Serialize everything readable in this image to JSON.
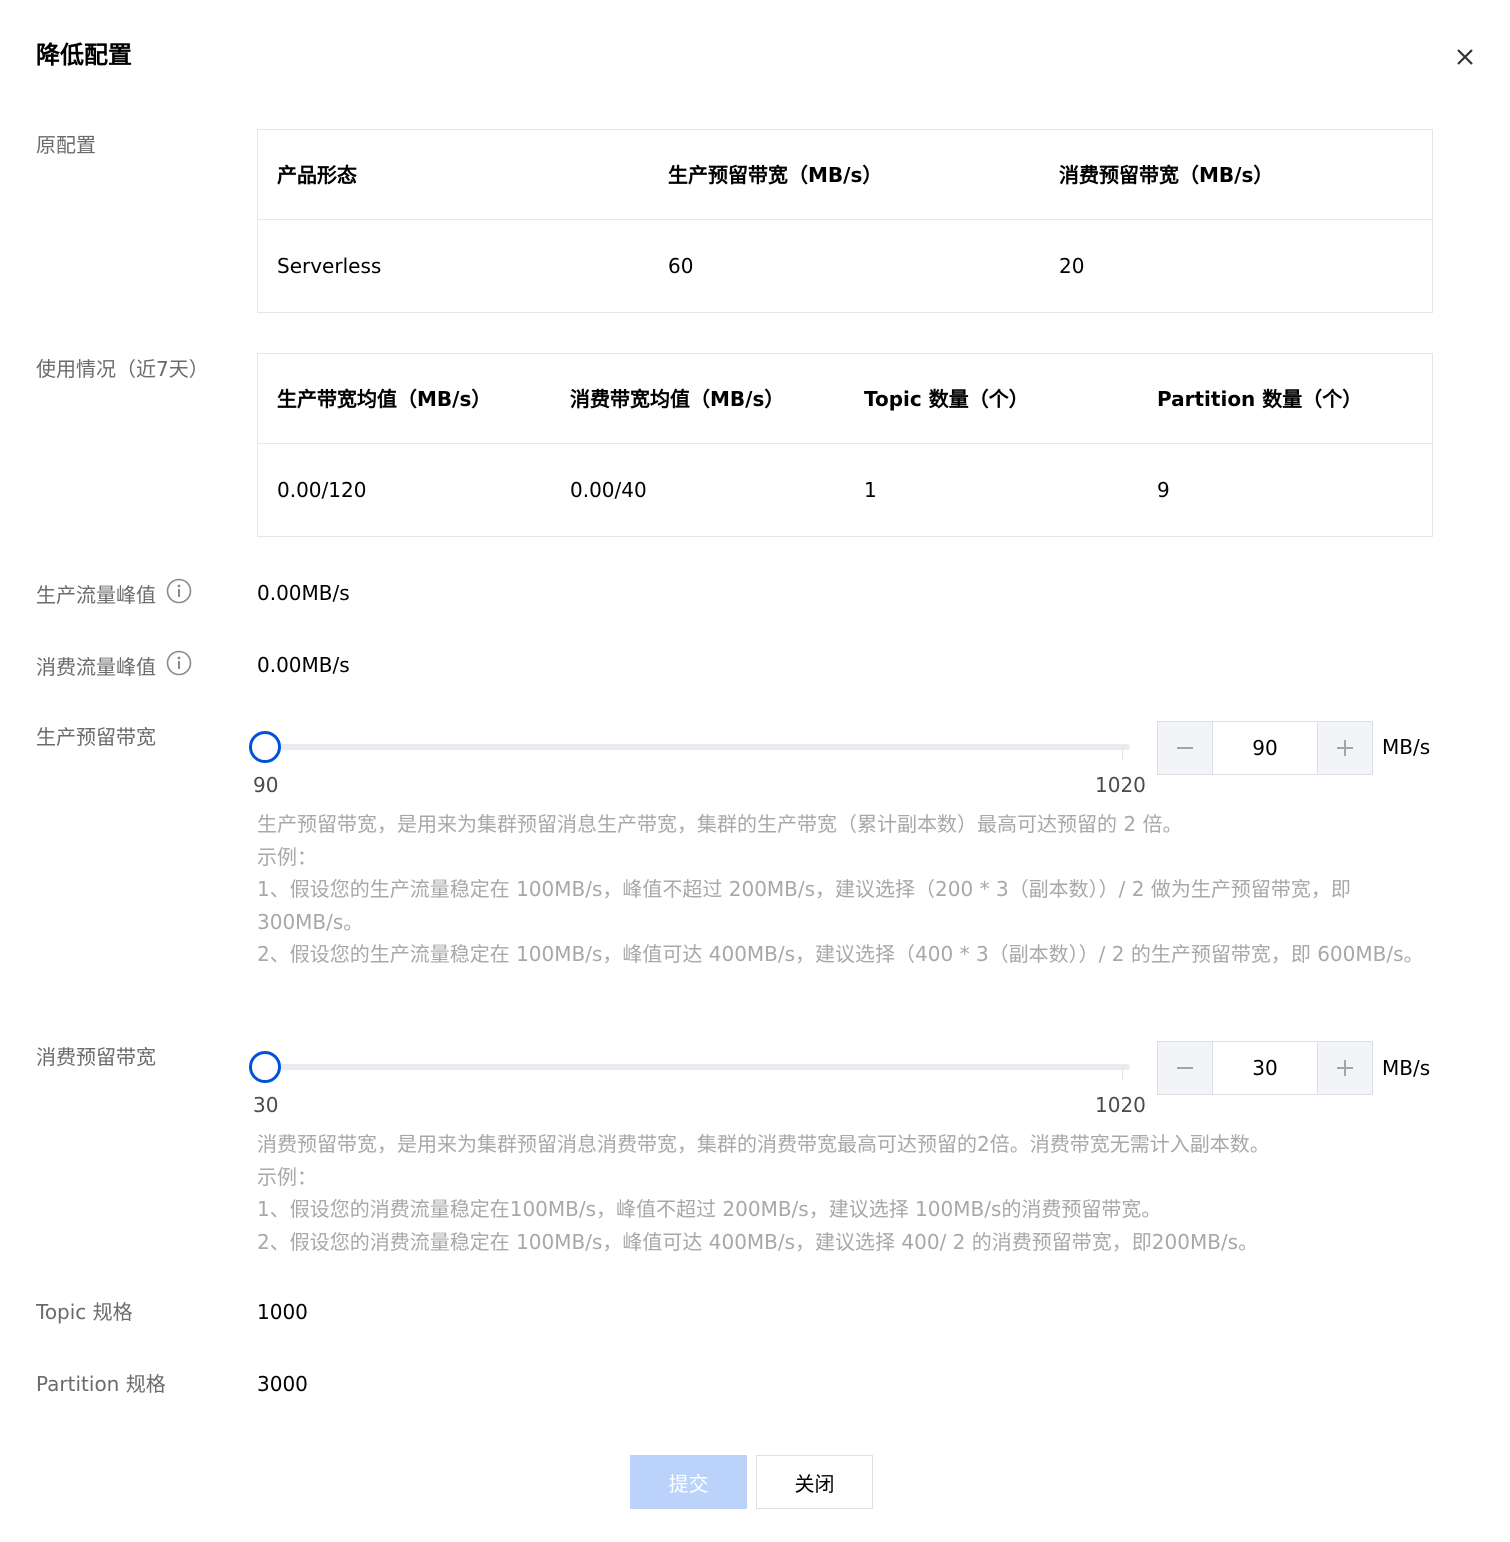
{
  "dialog": {
    "title": "降低配置"
  },
  "original_config": {
    "label": "原配置",
    "headers": [
      "产品形态",
      "生产预留带宽（MB/s）",
      "消费预留带宽（MB/s）"
    ],
    "row": [
      "Serverless",
      "60",
      "20"
    ]
  },
  "usage": {
    "label": "使用情况（近7天）",
    "headers": [
      "生产带宽均值（MB/s）",
      "消费带宽均值（MB/s）",
      "Topic 数量（个）",
      "Partition 数量（个）"
    ],
    "row": [
      "0.00/120",
      "0.00/40",
      "1",
      "9"
    ]
  },
  "produce_peak": {
    "label": "生产流量峰值",
    "value": "0.00MB/s"
  },
  "consume_peak": {
    "label": "消费流量峰值",
    "value": "0.00MB/s"
  },
  "produce_bandwidth": {
    "label": "生产预留带宽",
    "min_label": "90",
    "max_label": "1020",
    "value": "90",
    "unit": "MB/s",
    "help": [
      "生产预留带宽，是用来为集群预留消息生产带宽，集群的生产带宽（累计副本数）最高可达预留的 2 倍。",
      "示例：",
      "1、假设您的生产流量稳定在 100MB/s，峰值不超过 200MB/s，建议选择（200 * 3（副本数））/ 2 做为生产预留带宽，即 300MB/s。",
      "2、假设您的生产流量稳定在 100MB/s，峰值可达 400MB/s，建议选择（400 * 3（副本数））/ 2 的生产预留带宽，即 600MB/s。"
    ]
  },
  "consume_bandwidth": {
    "label": "消费预留带宽",
    "min_label": "30",
    "max_label": "1020",
    "value": "30",
    "unit": "MB/s",
    "help": [
      "消费预留带宽，是用来为集群预留消息消费带宽，集群的消费带宽最高可达预留的2倍。消费带宽无需计入副本数。",
      "示例：",
      "1、假设您的消费流量稳定在100MB/s，峰值不超过 200MB/s，建议选择 100MB/s的消费预留带宽。",
      "2、假设您的消费流量稳定在 100MB/s，峰值可达 400MB/s，建议选择 400/ 2 的消费预留带宽，即200MB/s。"
    ]
  },
  "topic_spec": {
    "label": "Topic 规格",
    "value": "1000"
  },
  "partition_spec": {
    "label": "Partition 规格",
    "value": "3000"
  },
  "footer": {
    "submit_label": "提交",
    "close_label": "关闭"
  },
  "colors": {
    "accent": "#0052d9",
    "submit_disabled_bg": "#bbd3fb",
    "label_text": "#6b6b6b",
    "help_text": "#a8a8a8",
    "border": "#e5e6eb"
  },
  "icons": {
    "close": "close-icon",
    "info": "info-circle-icon",
    "minus": "minus-icon",
    "plus": "plus-icon"
  }
}
